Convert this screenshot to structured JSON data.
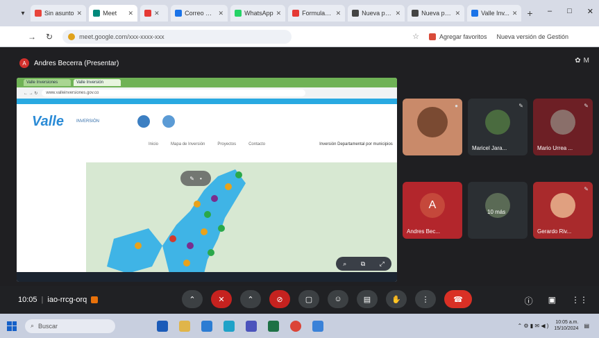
{
  "browser": {
    "tabs": [
      {
        "label": "Sin asunto",
        "color": "#e8453c"
      },
      {
        "label": "Meet",
        "color": "#00897b"
      },
      {
        "label": "",
        "color": "#e53935"
      },
      {
        "label": "Correo Mi...",
        "color": "#1a73e8"
      },
      {
        "label": "WhatsApp",
        "color": "#25d366"
      },
      {
        "label": "Formulari...",
        "color": "#e53935"
      },
      {
        "label": "Nueva pe...",
        "color": "#444444"
      },
      {
        "label": "Nueva pes...",
        "color": "#444444"
      },
      {
        "label": "Valle Inv...",
        "color": "#1a73e8"
      }
    ],
    "new_tab_glyph": "+",
    "window_controls": [
      "–",
      "□",
      "✕"
    ],
    "url": "meet.google.com/xxx-xxxx-xxx",
    "bookmarks": [
      "Agregar favoritos",
      "Nueva versión de Gestión"
    ]
  },
  "meet": {
    "presenter_initial": "A",
    "presenter_label": "Andres Becerra (Presentar)",
    "top_right": "M",
    "participants": [
      {
        "name": "Andres Bec...",
        "initial": "A",
        "bg": "#b3262c"
      },
      {
        "name": "Maricel Jara...",
        "initial": "",
        "bg": "#2b2f33"
      },
      {
        "name": "Mario Urrea ...",
        "initial": "",
        "bg": "#6d1f25"
      },
      {
        "name": "10 más",
        "initial": "",
        "bg": "#2b2f33"
      },
      {
        "name": "Gerardo Riv...",
        "initial": "",
        "bg": "#a92a2c"
      }
    ],
    "time": "10:05",
    "meeting_code": "iao-rrcg-orq"
  },
  "shared": {
    "tabs": [
      "Valle Inversiones",
      "Valle Inversión"
    ],
    "url": "www.valleinversiones.gov.co",
    "brand": "Valle",
    "brand_sub": "INVERSIÓN",
    "menu": [
      "Inicio",
      "Mapa de Inversión",
      "Proyectos",
      "Contacto"
    ],
    "menu_right": "Inversión Departamental por municipios"
  },
  "colors": {
    "accent": "#1a73e8",
    "hangup": "#d93025",
    "muted": "#c5221f"
  },
  "taskbar": {
    "search_placeholder": "Buscar",
    "time": "10:05 a.m.",
    "date": "15/10/2024"
  }
}
